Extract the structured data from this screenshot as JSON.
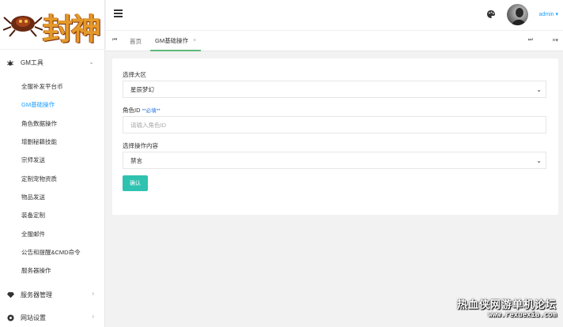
{
  "logo": {
    "text": "封神"
  },
  "sidebar": {
    "group_gm": {
      "label": "GM工具"
    },
    "items": [
      {
        "label": "全服补发平台币"
      },
      {
        "label": "GM基础操作",
        "active": true
      },
      {
        "label": "角色数据操作"
      },
      {
        "label": "增删秘籍技能"
      },
      {
        "label": "宗师发送"
      },
      {
        "label": "定制宠物资质"
      },
      {
        "label": "物品发送"
      },
      {
        "label": "装备定制"
      },
      {
        "label": "全服邮件"
      },
      {
        "label": "公告和提醒&CMD命令"
      },
      {
        "label": "服务器操作"
      }
    ],
    "group_server": {
      "label": "服务器管理"
    },
    "group_site": {
      "label": "网站设置"
    }
  },
  "header": {
    "user": "admin"
  },
  "tabs": {
    "items": [
      {
        "label": "首页"
      },
      {
        "label": "GM基础操作",
        "active": true
      }
    ]
  },
  "form": {
    "zone_label": "选择大区",
    "zone_value": "星辰梦幻",
    "role_label": "角色ID",
    "role_required": "**必填**",
    "role_placeholder": "请输入角色ID",
    "action_label": "选择操作内容",
    "action_value": "禁言",
    "submit_label": "确认"
  },
  "watermark": {
    "line1": "热血侠网游单机论坛",
    "line2": "www.rexuexia.com"
  },
  "colors": {
    "accent": "#1e9fff",
    "tab_active": "#5fb878",
    "button": "#2fc2b0"
  }
}
